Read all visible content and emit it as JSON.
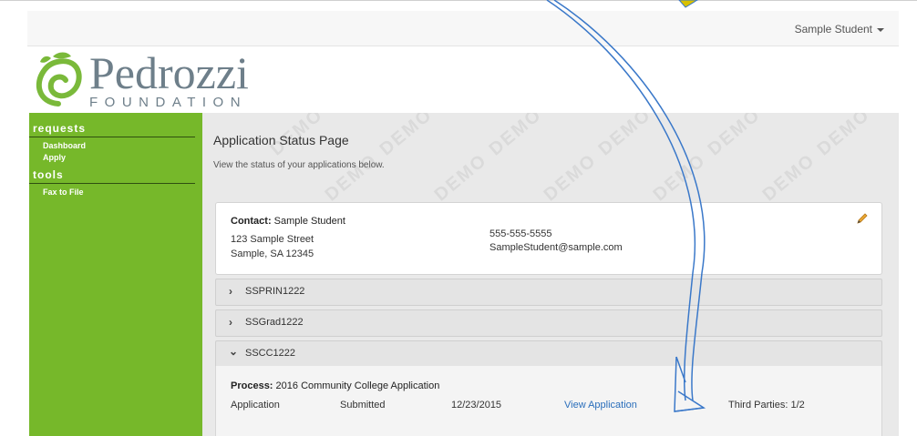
{
  "header": {
    "user_name": "Sample Student"
  },
  "logo": {
    "name": "Pedrozzi",
    "sub": "FOUNDATION"
  },
  "sidebar": {
    "sections": [
      {
        "title": "requests",
        "items": [
          "Dashboard",
          "Apply"
        ]
      },
      {
        "title": "tools",
        "items": [
          "Fax to File"
        ]
      }
    ]
  },
  "main": {
    "title": "Application Status Page",
    "subtitle": "View the status of your applications below.",
    "watermark_text": "DEMO",
    "contact": {
      "label": "Contact:",
      "name": "Sample Student",
      "address_line1": "123 Sample Street",
      "address_line2": "Sample, SA 12345",
      "phone": "555-555-5555",
      "email": "SampleStudent@sample.com"
    },
    "applications": [
      {
        "code": "SSPRIN1222",
        "expanded": false
      },
      {
        "code": "SSGrad1222",
        "expanded": false
      },
      {
        "code": "SSCC1222",
        "expanded": true
      }
    ],
    "expanded_detail": {
      "process_label": "Process:",
      "process_name": "2016 Community College Application",
      "type": "Application",
      "status": "Submitted",
      "date": "12/23/2015",
      "view_link": "View Application",
      "third_parties": "Third Parties: 1/2"
    }
  },
  "colors": {
    "sidebar": "#76b82a",
    "link": "#2a6ebb",
    "arrow": "#3a78c9"
  }
}
